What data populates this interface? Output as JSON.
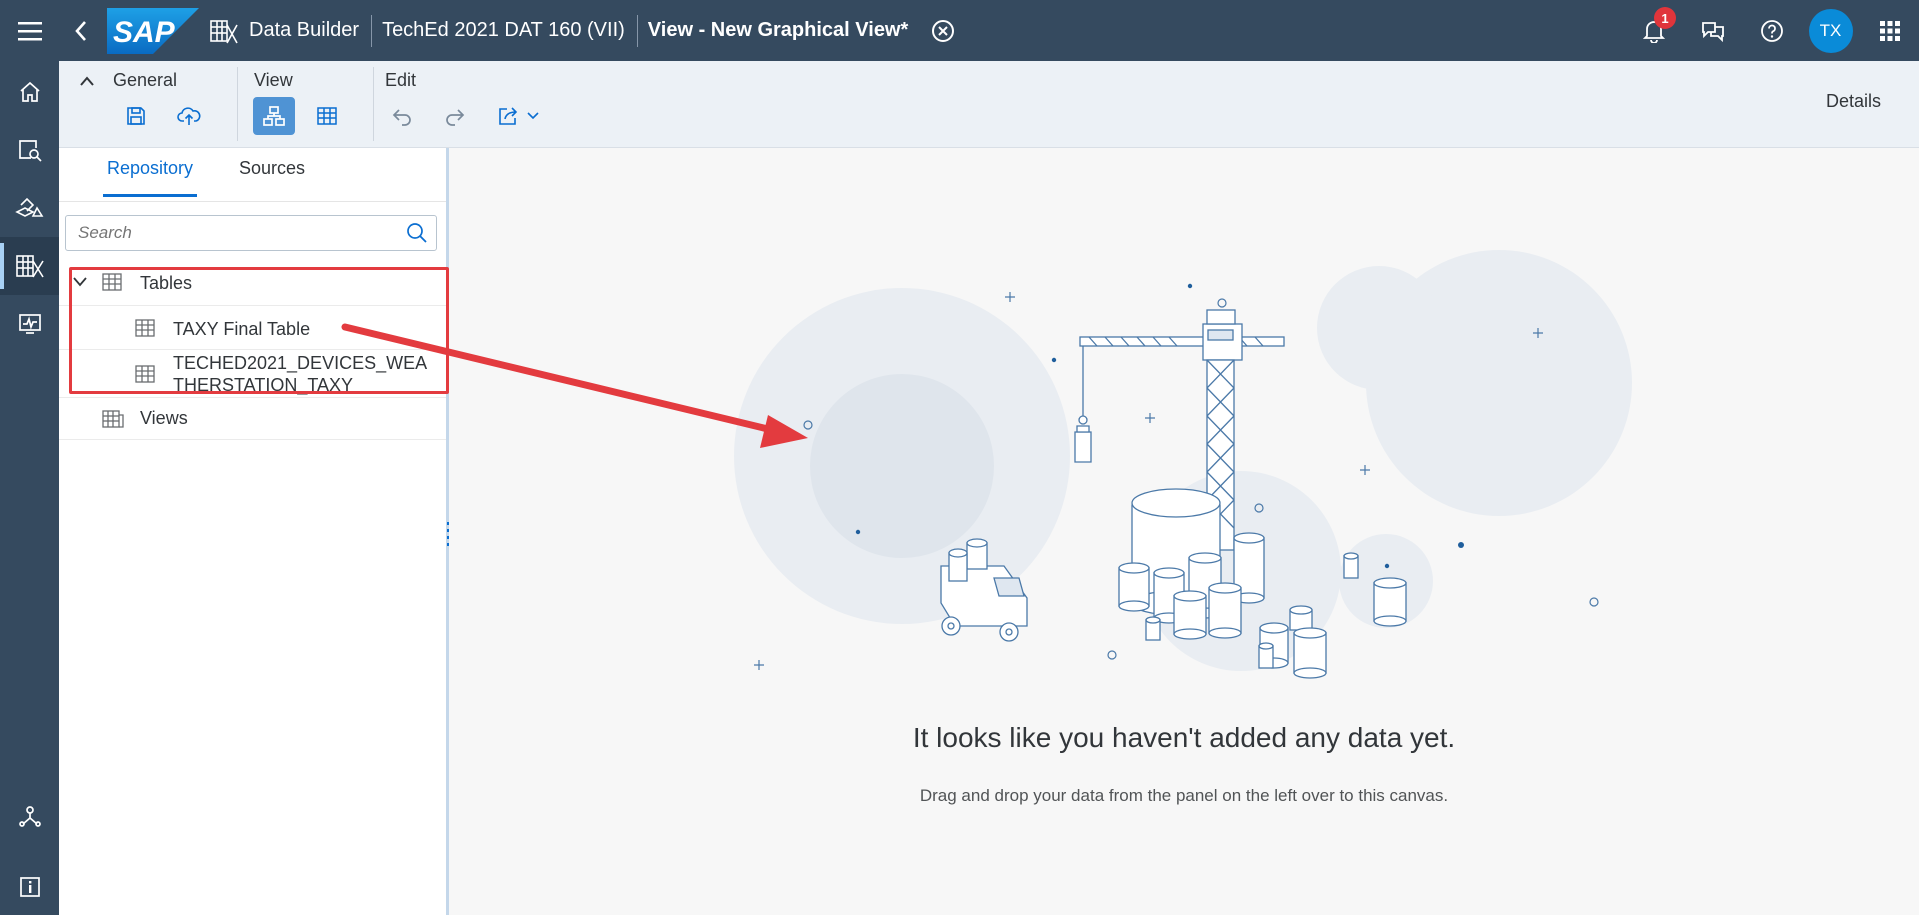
{
  "shell": {
    "logo_text": "SAP",
    "app_title": "Data Builder",
    "space_title": "TechEd 2021 DAT 160 (VII)",
    "view_title": "View - New Graphical View*",
    "notification_count": "1",
    "avatar_initials": "TX",
    "colors": {
      "shell_bg": "#354a5f",
      "badge": "#e0353b",
      "avatar": "#0a8bd8"
    }
  },
  "nav": {
    "items": [
      {
        "icon": "home-icon"
      },
      {
        "icon": "search-document-icon"
      },
      {
        "icon": "modeler-icon"
      },
      {
        "icon": "data-builder-icon",
        "active": true
      },
      {
        "icon": "monitor-icon"
      }
    ],
    "bottom": [
      {
        "icon": "network-icon"
      },
      {
        "icon": "info-icon"
      }
    ]
  },
  "toolbar": {
    "general_label": "General",
    "view_label": "View",
    "edit_label": "Edit",
    "details_label": "Details"
  },
  "panel": {
    "tabs": [
      "Repository",
      "Sources"
    ],
    "search_placeholder": "Search",
    "tree": {
      "tables_label": "Tables",
      "items": [
        "TAXY Final Table",
        "TECHED2021_DEVICES_WEA",
        "THERSTATION_TAXY"
      ],
      "views_label": "Views"
    }
  },
  "canvas": {
    "empty_title": "It looks like you haven't added any data yet.",
    "empty_desc": "Drag and drop your data from the panel on the left over to this canvas."
  }
}
